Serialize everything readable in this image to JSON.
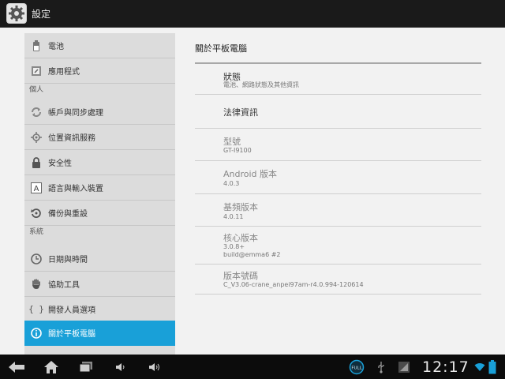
{
  "app": {
    "title": "設定"
  },
  "sidebar": {
    "items": [
      {
        "label": "電池",
        "icon": "battery-icon"
      },
      {
        "label": "應用程式",
        "icon": "apps-icon"
      },
      {
        "header": "個人"
      },
      {
        "label": "帳戶與同步處理",
        "icon": "sync-icon"
      },
      {
        "label": "位置資訊服務",
        "icon": "location-icon"
      },
      {
        "label": "安全性",
        "icon": "lock-icon"
      },
      {
        "label": "語言與輸入裝置",
        "icon": "language-icon"
      },
      {
        "label": "備份與重設",
        "icon": "backup-icon"
      },
      {
        "header": "系統"
      },
      {
        "label": "日期與時間",
        "icon": "clock-icon"
      },
      {
        "label": "協助工具",
        "icon": "hand-icon"
      },
      {
        "label": "開發人員選項",
        "icon": "braces-icon"
      },
      {
        "label": "關於平板電腦",
        "icon": "info-icon",
        "selected": true
      }
    ]
  },
  "content": {
    "title": "關於平板電腦",
    "prefs": [
      {
        "title": "狀態",
        "summary": "電池、網路狀態及其他資訊"
      },
      {
        "title": "法律資訊"
      },
      {
        "title": "型號",
        "summary": "GT-I9100"
      },
      {
        "title": "Android 版本",
        "summary": "4.0.3"
      },
      {
        "title": "基頻版本",
        "summary": "4.0.11"
      },
      {
        "title": "核心版本",
        "summary": "3.0.8+",
        "summary2": "build@emma6 #2"
      },
      {
        "title": "版本號碼",
        "summary": "C_V3.06-crane_anpei97am-r4.0.994-120614"
      }
    ]
  },
  "navbar": {
    "clock": "12:17",
    "status_badge": "FULL",
    "accent": "#19a0d8"
  }
}
